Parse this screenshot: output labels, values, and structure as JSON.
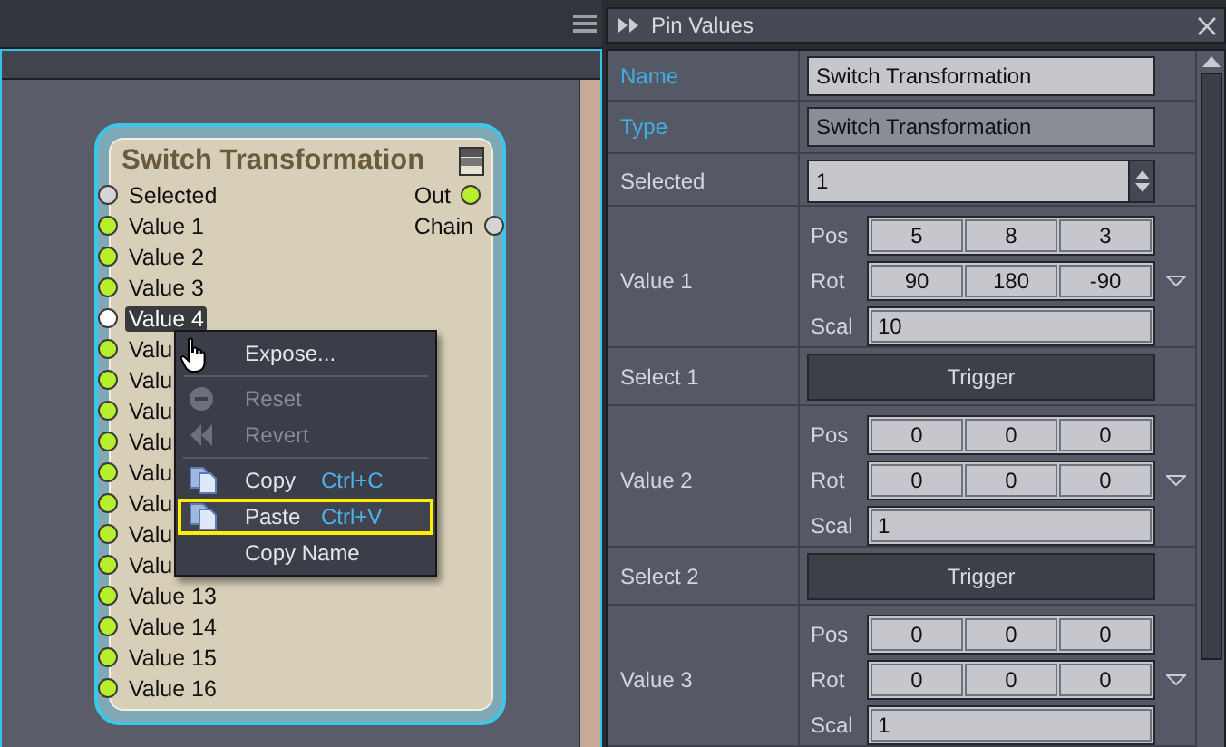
{
  "node_editor": {
    "node": {
      "title": "Switch Transformation",
      "inputs": [
        {
          "label": "Selected",
          "color": "#d4d4d4",
          "hovered": false
        },
        {
          "label": "Value 1",
          "color": "#b6f02c",
          "hovered": false
        },
        {
          "label": "Value 2",
          "color": "#b6f02c",
          "hovered": false
        },
        {
          "label": "Value 3",
          "color": "#b6f02c",
          "hovered": false
        },
        {
          "label": "Value 4",
          "color": "#ffffff",
          "hovered": true
        },
        {
          "label": "Valu",
          "color": "#b6f02c",
          "hovered": false
        },
        {
          "label": "Valu",
          "color": "#b6f02c",
          "hovered": false
        },
        {
          "label": "Valu",
          "color": "#b6f02c",
          "hovered": false
        },
        {
          "label": "Valu",
          "color": "#b6f02c",
          "hovered": false
        },
        {
          "label": "Valu",
          "color": "#b6f02c",
          "hovered": false
        },
        {
          "label": "Valu",
          "color": "#b6f02c",
          "hovered": false
        },
        {
          "label": "Valu",
          "color": "#b6f02c",
          "hovered": false
        },
        {
          "label": "Valu",
          "color": "#b6f02c",
          "hovered": false
        },
        {
          "label": "Value 13",
          "color": "#b6f02c",
          "hovered": false
        },
        {
          "label": "Value 14",
          "color": "#b6f02c",
          "hovered": false
        },
        {
          "label": "Value 15",
          "color": "#b6f02c",
          "hovered": false
        },
        {
          "label": "Value 16",
          "color": "#b6f02c",
          "hovered": false
        }
      ],
      "outputs": [
        {
          "label": "Out",
          "color": "#b6f02c"
        },
        {
          "label": "Chain",
          "color": "#d4d4d4"
        }
      ]
    },
    "context_menu": {
      "items": [
        {
          "kind": "item",
          "label": "Expose...",
          "disabled": false,
          "highlighted": false
        },
        {
          "kind": "separator"
        },
        {
          "kind": "item",
          "label": "Reset",
          "disabled": true,
          "highlighted": false
        },
        {
          "kind": "item",
          "label": "Revert",
          "disabled": true,
          "highlighted": false
        },
        {
          "kind": "separator"
        },
        {
          "kind": "item",
          "label": "Copy",
          "shortcut": "Ctrl+C",
          "disabled": false,
          "highlighted": false
        },
        {
          "kind": "item",
          "label": "Paste",
          "shortcut": "Ctrl+V",
          "disabled": false,
          "highlighted": true
        },
        {
          "kind": "item",
          "label": "Copy Name",
          "disabled": false,
          "highlighted": false
        }
      ]
    }
  },
  "pin_values": {
    "title": "Pin Values",
    "rows": [
      {
        "kind": "text",
        "label": "Name",
        "accent": true,
        "value": "Switch Transformation",
        "readonly": false
      },
      {
        "kind": "text",
        "label": "Type",
        "accent": true,
        "value": "Switch Transformation",
        "readonly": true
      },
      {
        "kind": "spin",
        "label": "Selected",
        "accent": false,
        "value": "1"
      },
      {
        "kind": "transform",
        "label": "Value 1",
        "accent": false,
        "parts": [
          {
            "label": "Pos",
            "values": [
              "5",
              "8",
              "3"
            ]
          },
          {
            "label": "Rot",
            "values": [
              "90",
              "180",
              "-90"
            ]
          },
          {
            "label": "Scal",
            "values": [
              "10"
            ]
          }
        ]
      },
      {
        "kind": "trigger",
        "label": "Select 1",
        "accent": false,
        "button": "Trigger"
      },
      {
        "kind": "transform",
        "label": "Value 2",
        "accent": false,
        "parts": [
          {
            "label": "Pos",
            "values": [
              "0",
              "0",
              "0"
            ]
          },
          {
            "label": "Rot",
            "values": [
              "0",
              "0",
              "0"
            ]
          },
          {
            "label": "Scal",
            "values": [
              "1"
            ]
          }
        ]
      },
      {
        "kind": "trigger",
        "label": "Select 2",
        "accent": false,
        "button": "Trigger"
      },
      {
        "kind": "transform",
        "label": "Value 3",
        "accent": false,
        "parts": [
          {
            "label": "Pos",
            "values": [
              "0",
              "0",
              "0"
            ]
          },
          {
            "label": "Rot",
            "values": [
              "0",
              "0",
              "0"
            ]
          },
          {
            "label": "Scal",
            "values": [
              "1"
            ]
          }
        ]
      }
    ]
  }
}
